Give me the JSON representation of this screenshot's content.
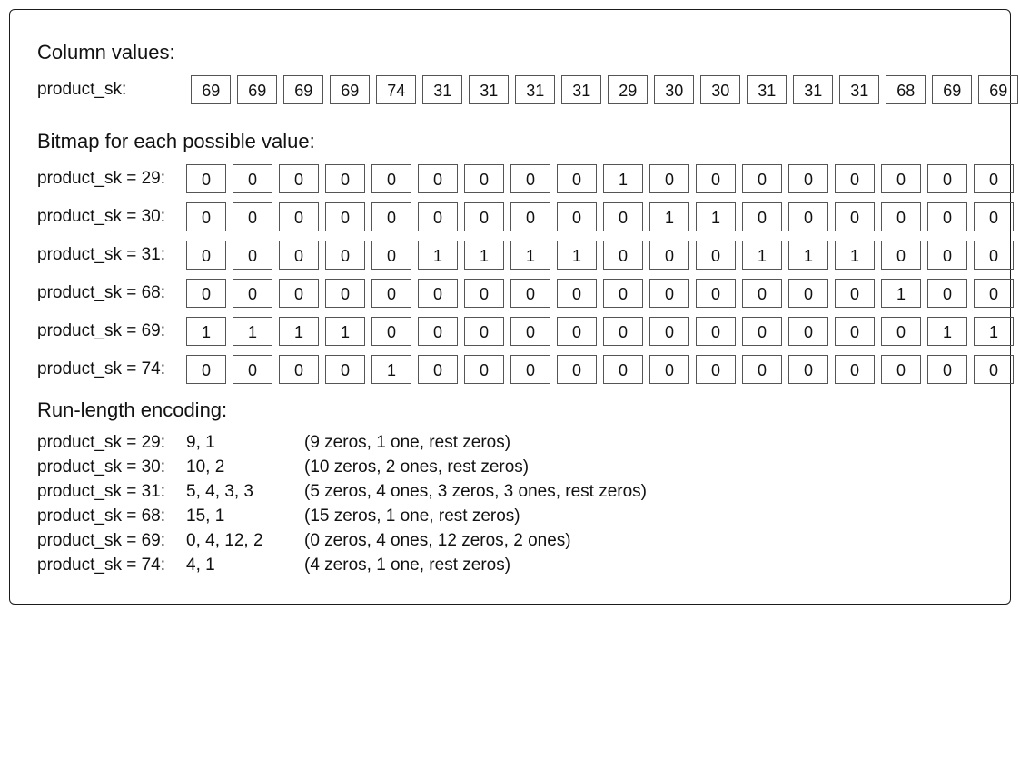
{
  "section_titles": {
    "column_values": "Column values:",
    "bitmap": "Bitmap for each possible value:",
    "rle": "Run-length encoding:"
  },
  "column_values": {
    "label": "product_sk:",
    "values": [
      69,
      69,
      69,
      69,
      74,
      31,
      31,
      31,
      31,
      29,
      30,
      30,
      31,
      31,
      31,
      68,
      69,
      69
    ]
  },
  "bitmaps": [
    {
      "label": "product_sk = 29:",
      "bits": [
        0,
        0,
        0,
        0,
        0,
        0,
        0,
        0,
        0,
        1,
        0,
        0,
        0,
        0,
        0,
        0,
        0,
        0
      ]
    },
    {
      "label": "product_sk = 30:",
      "bits": [
        0,
        0,
        0,
        0,
        0,
        0,
        0,
        0,
        0,
        0,
        1,
        1,
        0,
        0,
        0,
        0,
        0,
        0
      ]
    },
    {
      "label": "product_sk = 31:",
      "bits": [
        0,
        0,
        0,
        0,
        0,
        1,
        1,
        1,
        1,
        0,
        0,
        0,
        1,
        1,
        1,
        0,
        0,
        0
      ]
    },
    {
      "label": "product_sk = 68:",
      "bits": [
        0,
        0,
        0,
        0,
        0,
        0,
        0,
        0,
        0,
        0,
        0,
        0,
        0,
        0,
        0,
        1,
        0,
        0
      ]
    },
    {
      "label": "product_sk = 69:",
      "bits": [
        1,
        1,
        1,
        1,
        0,
        0,
        0,
        0,
        0,
        0,
        0,
        0,
        0,
        0,
        0,
        0,
        1,
        1
      ]
    },
    {
      "label": "product_sk = 74:",
      "bits": [
        0,
        0,
        0,
        0,
        1,
        0,
        0,
        0,
        0,
        0,
        0,
        0,
        0,
        0,
        0,
        0,
        0,
        0
      ]
    }
  ],
  "rle": [
    {
      "label": "product_sk = 29:",
      "code": "9, 1",
      "note": "(9 zeros, 1 one, rest zeros)"
    },
    {
      "label": "product_sk = 30:",
      "code": "10, 2",
      "note": "(10 zeros, 2 ones, rest zeros)"
    },
    {
      "label": "product_sk = 31:",
      "code": "5, 4, 3, 3",
      "note": "(5 zeros, 4 ones, 3 zeros, 3 ones, rest zeros)"
    },
    {
      "label": "product_sk = 68:",
      "code": "15, 1",
      "note": "(15 zeros, 1 one, rest zeros)"
    },
    {
      "label": "product_sk = 69:",
      "code": "0, 4, 12, 2",
      "note": "(0 zeros, 4 ones, 12 zeros, 2 ones)"
    },
    {
      "label": "product_sk = 74:",
      "code": "4, 1",
      "note": "(4 zeros, 1 one, rest zeros)"
    }
  ]
}
